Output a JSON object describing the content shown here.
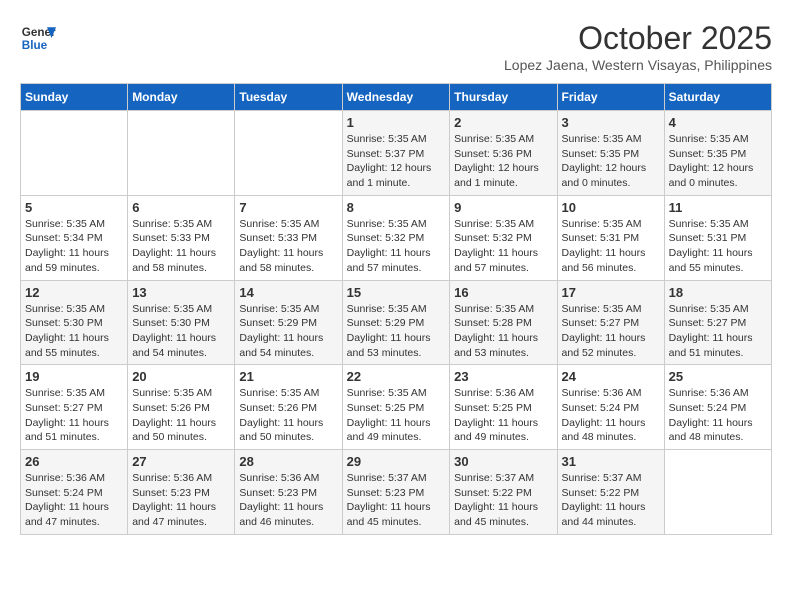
{
  "header": {
    "logo_line1": "General",
    "logo_line2": "Blue",
    "month": "October 2025",
    "location": "Lopez Jaena, Western Visayas, Philippines"
  },
  "weekdays": [
    "Sunday",
    "Monday",
    "Tuesday",
    "Wednesday",
    "Thursday",
    "Friday",
    "Saturday"
  ],
  "weeks": [
    [
      {
        "day": "",
        "text": ""
      },
      {
        "day": "",
        "text": ""
      },
      {
        "day": "",
        "text": ""
      },
      {
        "day": "1",
        "text": "Sunrise: 5:35 AM\nSunset: 5:37 PM\nDaylight: 12 hours\nand 1 minute."
      },
      {
        "day": "2",
        "text": "Sunrise: 5:35 AM\nSunset: 5:36 PM\nDaylight: 12 hours\nand 1 minute."
      },
      {
        "day": "3",
        "text": "Sunrise: 5:35 AM\nSunset: 5:35 PM\nDaylight: 12 hours\nand 0 minutes."
      },
      {
        "day": "4",
        "text": "Sunrise: 5:35 AM\nSunset: 5:35 PM\nDaylight: 12 hours\nand 0 minutes."
      }
    ],
    [
      {
        "day": "5",
        "text": "Sunrise: 5:35 AM\nSunset: 5:34 PM\nDaylight: 11 hours\nand 59 minutes."
      },
      {
        "day": "6",
        "text": "Sunrise: 5:35 AM\nSunset: 5:33 PM\nDaylight: 11 hours\nand 58 minutes."
      },
      {
        "day": "7",
        "text": "Sunrise: 5:35 AM\nSunset: 5:33 PM\nDaylight: 11 hours\nand 58 minutes."
      },
      {
        "day": "8",
        "text": "Sunrise: 5:35 AM\nSunset: 5:32 PM\nDaylight: 11 hours\nand 57 minutes."
      },
      {
        "day": "9",
        "text": "Sunrise: 5:35 AM\nSunset: 5:32 PM\nDaylight: 11 hours\nand 57 minutes."
      },
      {
        "day": "10",
        "text": "Sunrise: 5:35 AM\nSunset: 5:31 PM\nDaylight: 11 hours\nand 56 minutes."
      },
      {
        "day": "11",
        "text": "Sunrise: 5:35 AM\nSunset: 5:31 PM\nDaylight: 11 hours\nand 55 minutes."
      }
    ],
    [
      {
        "day": "12",
        "text": "Sunrise: 5:35 AM\nSunset: 5:30 PM\nDaylight: 11 hours\nand 55 minutes."
      },
      {
        "day": "13",
        "text": "Sunrise: 5:35 AM\nSunset: 5:30 PM\nDaylight: 11 hours\nand 54 minutes."
      },
      {
        "day": "14",
        "text": "Sunrise: 5:35 AM\nSunset: 5:29 PM\nDaylight: 11 hours\nand 54 minutes."
      },
      {
        "day": "15",
        "text": "Sunrise: 5:35 AM\nSunset: 5:29 PM\nDaylight: 11 hours\nand 53 minutes."
      },
      {
        "day": "16",
        "text": "Sunrise: 5:35 AM\nSunset: 5:28 PM\nDaylight: 11 hours\nand 53 minutes."
      },
      {
        "day": "17",
        "text": "Sunrise: 5:35 AM\nSunset: 5:27 PM\nDaylight: 11 hours\nand 52 minutes."
      },
      {
        "day": "18",
        "text": "Sunrise: 5:35 AM\nSunset: 5:27 PM\nDaylight: 11 hours\nand 51 minutes."
      }
    ],
    [
      {
        "day": "19",
        "text": "Sunrise: 5:35 AM\nSunset: 5:27 PM\nDaylight: 11 hours\nand 51 minutes."
      },
      {
        "day": "20",
        "text": "Sunrise: 5:35 AM\nSunset: 5:26 PM\nDaylight: 11 hours\nand 50 minutes."
      },
      {
        "day": "21",
        "text": "Sunrise: 5:35 AM\nSunset: 5:26 PM\nDaylight: 11 hours\nand 50 minutes."
      },
      {
        "day": "22",
        "text": "Sunrise: 5:35 AM\nSunset: 5:25 PM\nDaylight: 11 hours\nand 49 minutes."
      },
      {
        "day": "23",
        "text": "Sunrise: 5:36 AM\nSunset: 5:25 PM\nDaylight: 11 hours\nand 49 minutes."
      },
      {
        "day": "24",
        "text": "Sunrise: 5:36 AM\nSunset: 5:24 PM\nDaylight: 11 hours\nand 48 minutes."
      },
      {
        "day": "25",
        "text": "Sunrise: 5:36 AM\nSunset: 5:24 PM\nDaylight: 11 hours\nand 48 minutes."
      }
    ],
    [
      {
        "day": "26",
        "text": "Sunrise: 5:36 AM\nSunset: 5:24 PM\nDaylight: 11 hours\nand 47 minutes."
      },
      {
        "day": "27",
        "text": "Sunrise: 5:36 AM\nSunset: 5:23 PM\nDaylight: 11 hours\nand 47 minutes."
      },
      {
        "day": "28",
        "text": "Sunrise: 5:36 AM\nSunset: 5:23 PM\nDaylight: 11 hours\nand 46 minutes."
      },
      {
        "day": "29",
        "text": "Sunrise: 5:37 AM\nSunset: 5:23 PM\nDaylight: 11 hours\nand 45 minutes."
      },
      {
        "day": "30",
        "text": "Sunrise: 5:37 AM\nSunset: 5:22 PM\nDaylight: 11 hours\nand 45 minutes."
      },
      {
        "day": "31",
        "text": "Sunrise: 5:37 AM\nSunset: 5:22 PM\nDaylight: 11 hours\nand 44 minutes."
      },
      {
        "day": "",
        "text": ""
      }
    ]
  ]
}
